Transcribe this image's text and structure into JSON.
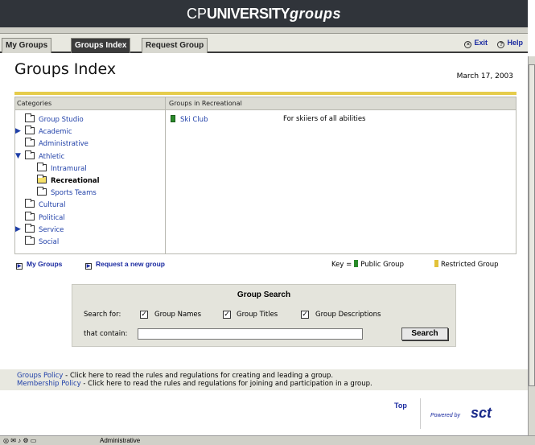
{
  "banner": {
    "brand_prefix": "CP",
    "brand_bold": "UNIVERSITY",
    "brand_italic": "groups"
  },
  "tabs": [
    {
      "label": "My Groups",
      "active": false
    },
    {
      "label": "Groups Index",
      "active": true
    },
    {
      "label": "Request Group",
      "active": false
    }
  ],
  "top_links": {
    "exit": "Exit",
    "help": "Help"
  },
  "page": {
    "title": "Groups Index",
    "date": "March 17, 2003"
  },
  "categories_panel": {
    "header_left": "Categories",
    "header_right": "Groups in Recreational",
    "items": [
      {
        "label": "Group Studio",
        "indent": 0,
        "expander": ""
      },
      {
        "label": "Academic",
        "indent": 0,
        "expander": "▶"
      },
      {
        "label": "Administrative",
        "indent": 0,
        "expander": ""
      },
      {
        "label": "Athletic",
        "indent": 0,
        "expander": "▼"
      },
      {
        "label": "Intramural",
        "indent": 1,
        "expander": ""
      },
      {
        "label": "Recreational",
        "indent": 1,
        "expander": "",
        "selected": true
      },
      {
        "label": "Sports Teams",
        "indent": 1,
        "expander": ""
      },
      {
        "label": "Cultural",
        "indent": 0,
        "expander": ""
      },
      {
        "label": "Political",
        "indent": 0,
        "expander": ""
      },
      {
        "label": "Service",
        "indent": 0,
        "expander": "▶"
      },
      {
        "label": "Social",
        "indent": 0,
        "expander": ""
      }
    ],
    "groups": [
      {
        "name": "Ski Club",
        "description": "For skiiers of all abilities"
      }
    ]
  },
  "links_row": {
    "my_groups": "My Groups",
    "request_group": "Request a new group",
    "key_label": "Key =",
    "public_group": "Public Group",
    "restricted_group": "Restricted Group"
  },
  "search": {
    "title": "Group Search",
    "search_for_label": "Search for:",
    "options": [
      {
        "label": "Group Names",
        "checked": true
      },
      {
        "label": "Group Titles",
        "checked": true
      },
      {
        "label": "Group Descriptions",
        "checked": true
      }
    ],
    "contain_label": "that contain:",
    "input_value": "",
    "button_label": "Search"
  },
  "policies": [
    {
      "link": "Groups Policy",
      "text": " - Click here to read the rules and regulations for creating and leading a group."
    },
    {
      "link": "Membership Policy",
      "text": " - Click here to read the rules and regulations for joining and participation in a group."
    }
  ],
  "footer": {
    "top_link": "Top",
    "powered_by": "Powered by",
    "logo_text": "sct"
  },
  "status_bar": {
    "text": "Administrative"
  },
  "colors": {
    "link": "#1f3fa8",
    "accent_gold": "#e6cc4c",
    "public_green": "#2a8a2a",
    "restricted_gold": "#e2c23a"
  }
}
